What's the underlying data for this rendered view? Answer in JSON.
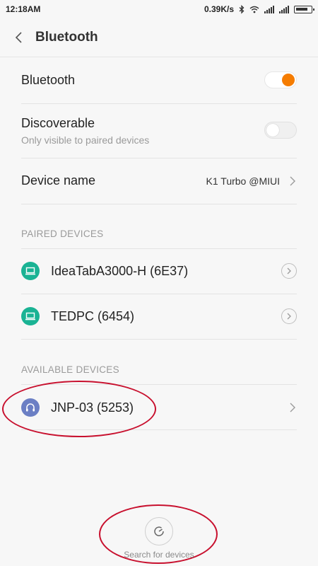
{
  "status": {
    "time": "12:18AM",
    "speed": "0.39K/s"
  },
  "header": {
    "title": "Bluetooth"
  },
  "bluetooth": {
    "label": "Bluetooth",
    "enabled": true
  },
  "discoverable": {
    "label": "Discoverable",
    "subtitle": "Only visible to paired devices",
    "enabled": false
  },
  "device_name": {
    "label": "Device name",
    "value": "K1 Turbo @MIUI"
  },
  "paired": {
    "header": "PAIRED DEVICES",
    "items": [
      {
        "name": "IdeaTabA3000-H (6E37)",
        "icon": "laptop-icon"
      },
      {
        "name": "TEDPC (6454)",
        "icon": "laptop-icon"
      }
    ]
  },
  "available": {
    "header": "AVAILABLE DEVICES",
    "items": [
      {
        "name": "JNP-03 (5253)",
        "icon": "headphones-icon"
      }
    ]
  },
  "search": {
    "label": "Search for devices"
  },
  "colors": {
    "accent": "#f57c00",
    "teal": "#1ab394",
    "purple": "#6b7fc4",
    "annotation": "#c8102e"
  }
}
